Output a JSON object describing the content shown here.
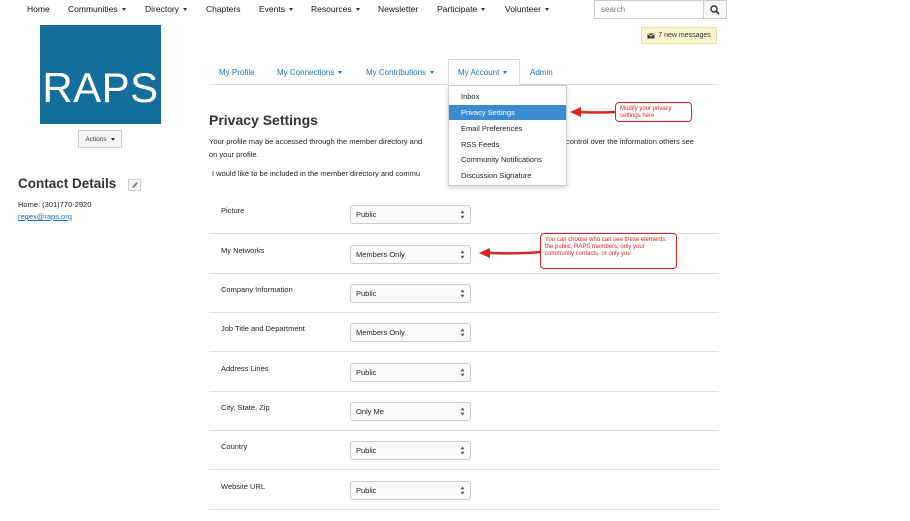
{
  "topnav": {
    "items": [
      {
        "label": "Home"
      },
      {
        "label": "Communities"
      },
      {
        "label": "Directory"
      },
      {
        "label": "Chapters"
      },
      {
        "label": "Events"
      },
      {
        "label": "Resources"
      },
      {
        "label": "Newsletter"
      },
      {
        "label": "Participate"
      },
      {
        "label": "Volunteer"
      }
    ],
    "search_placeholder": "search",
    "search_icon": "magnifier-icon"
  },
  "messages": {
    "label": "7 new messages",
    "icon": "envelope-icon"
  },
  "sidebar": {
    "logo_text": "RAPS",
    "logo_color": "#136f9a",
    "actions_label": "Actions",
    "contact_title": "Contact Details",
    "phone": "Home: (301)770-2920",
    "email": "regex@raps.org"
  },
  "tabs": [
    {
      "label": "My Profile"
    },
    {
      "label": "My Connections"
    },
    {
      "label": "My Contributions"
    },
    {
      "label": "My Account"
    },
    {
      "label": "Admin"
    }
  ],
  "account_menu": [
    {
      "label": "Inbox"
    },
    {
      "label": "Privacy Settings"
    },
    {
      "label": "Email Preferences"
    },
    {
      "label": "RSS Feeds"
    },
    {
      "label": "Community Notifications"
    },
    {
      "label": "Discussion Signature"
    }
  ],
  "main": {
    "title": "Privacy Settings",
    "intro_part1": "Your profile may be accessed through the member directory and",
    "intro_part2": "control over the information others see",
    "intro_line2": "on your profile.",
    "include_text": "I would like to be included in the member directory and commu"
  },
  "settings": [
    {
      "label": "Picture",
      "value": "Public"
    },
    {
      "label": "My Networks",
      "value": "Members Only"
    },
    {
      "label": "Company Information",
      "value": "Public"
    },
    {
      "label": "Job Title and Department",
      "value": "Members Only"
    },
    {
      "label": "Address Lines",
      "value": "Public"
    },
    {
      "label": "City, State, Zip",
      "value": "Only Me"
    },
    {
      "label": "Country",
      "value": "Public"
    },
    {
      "label": "Website URL",
      "value": "Public"
    }
  ],
  "callouts": {
    "privacy": "Modify your privacy settings here",
    "networks": "You can choose who can see these elements: the public, RAPS members, only your community contacts, or only you"
  },
  "colors": {
    "link": "#1a73b5",
    "accent": "#3a8cd1",
    "callout": "#d9261c",
    "messages_bg": "#fcf3cf"
  }
}
